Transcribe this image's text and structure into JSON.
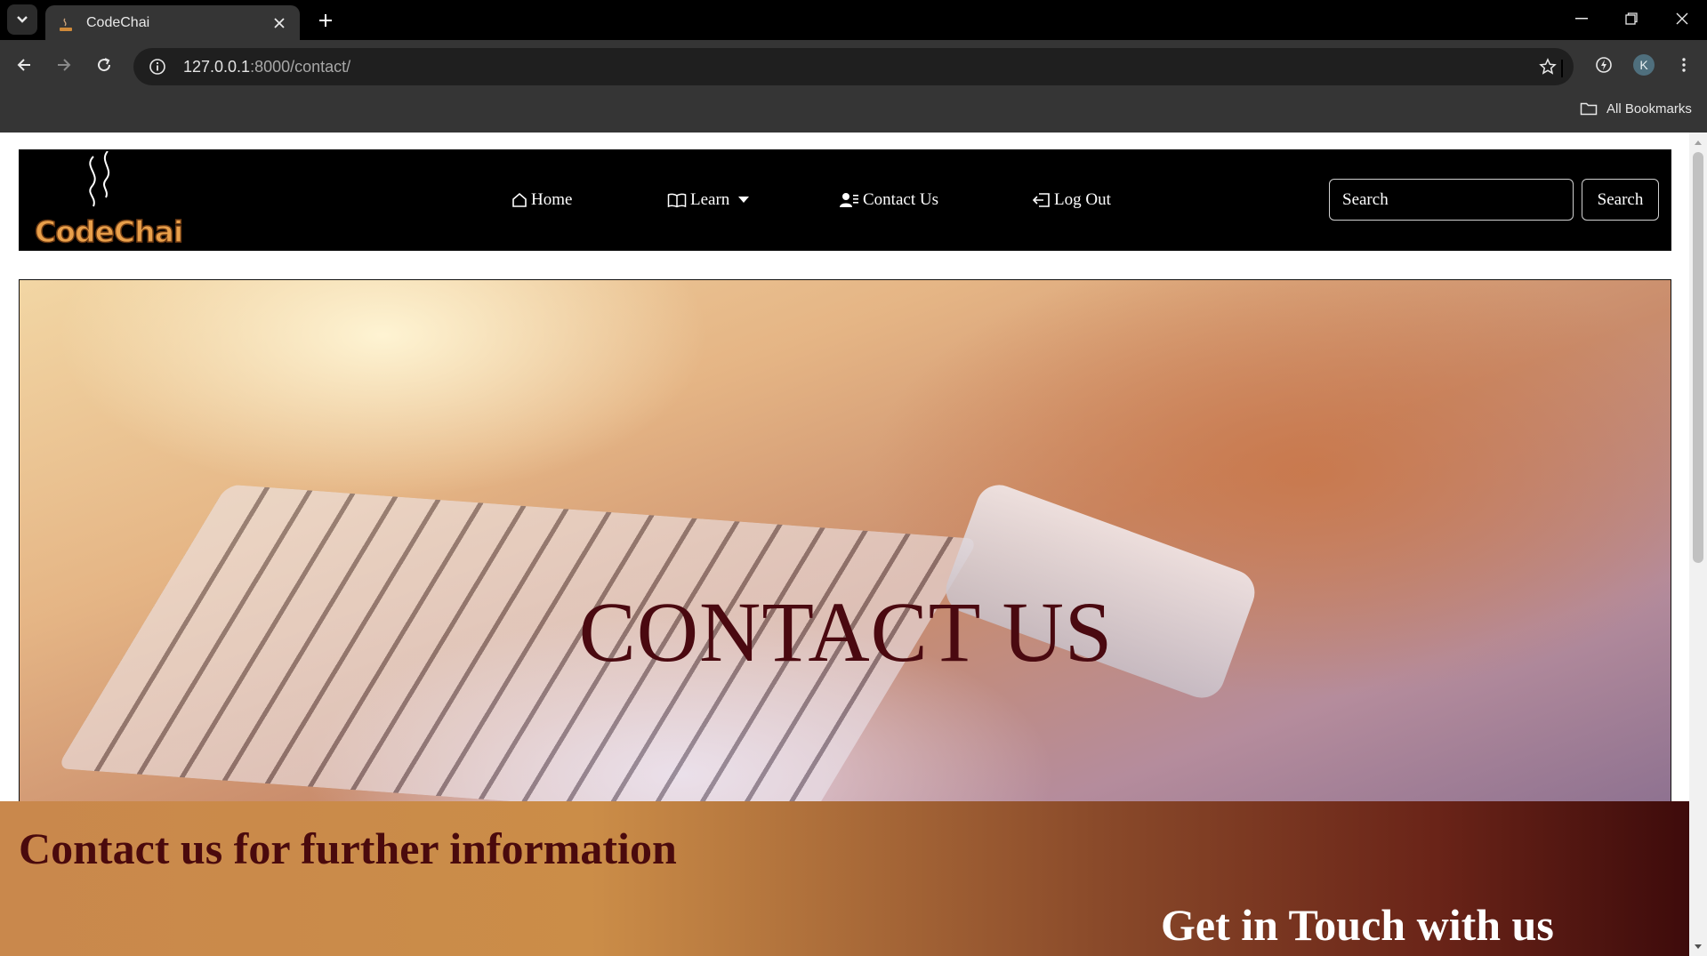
{
  "browser": {
    "tab_title": "CodeChai",
    "url_host": "127.0.0.1",
    "url_path": ":8000/contact/",
    "profile_initial": "K",
    "bookmarks_label": "All Bookmarks"
  },
  "site": {
    "logo_text": "CodeChai",
    "nav": {
      "home": "Home",
      "learn": "Learn",
      "contact": "Contact Us",
      "logout": "Log Out"
    },
    "search_placeholder": "Search",
    "search_button": "Search"
  },
  "hero": {
    "title": "CONTACT US"
  },
  "info": {
    "heading": "Contact us for further information",
    "subheading": "Get in Touch with us"
  },
  "colors": {
    "brand_orange": "#e9a04b",
    "hero_text": "#4a0910",
    "nav_bg": "#000000"
  }
}
